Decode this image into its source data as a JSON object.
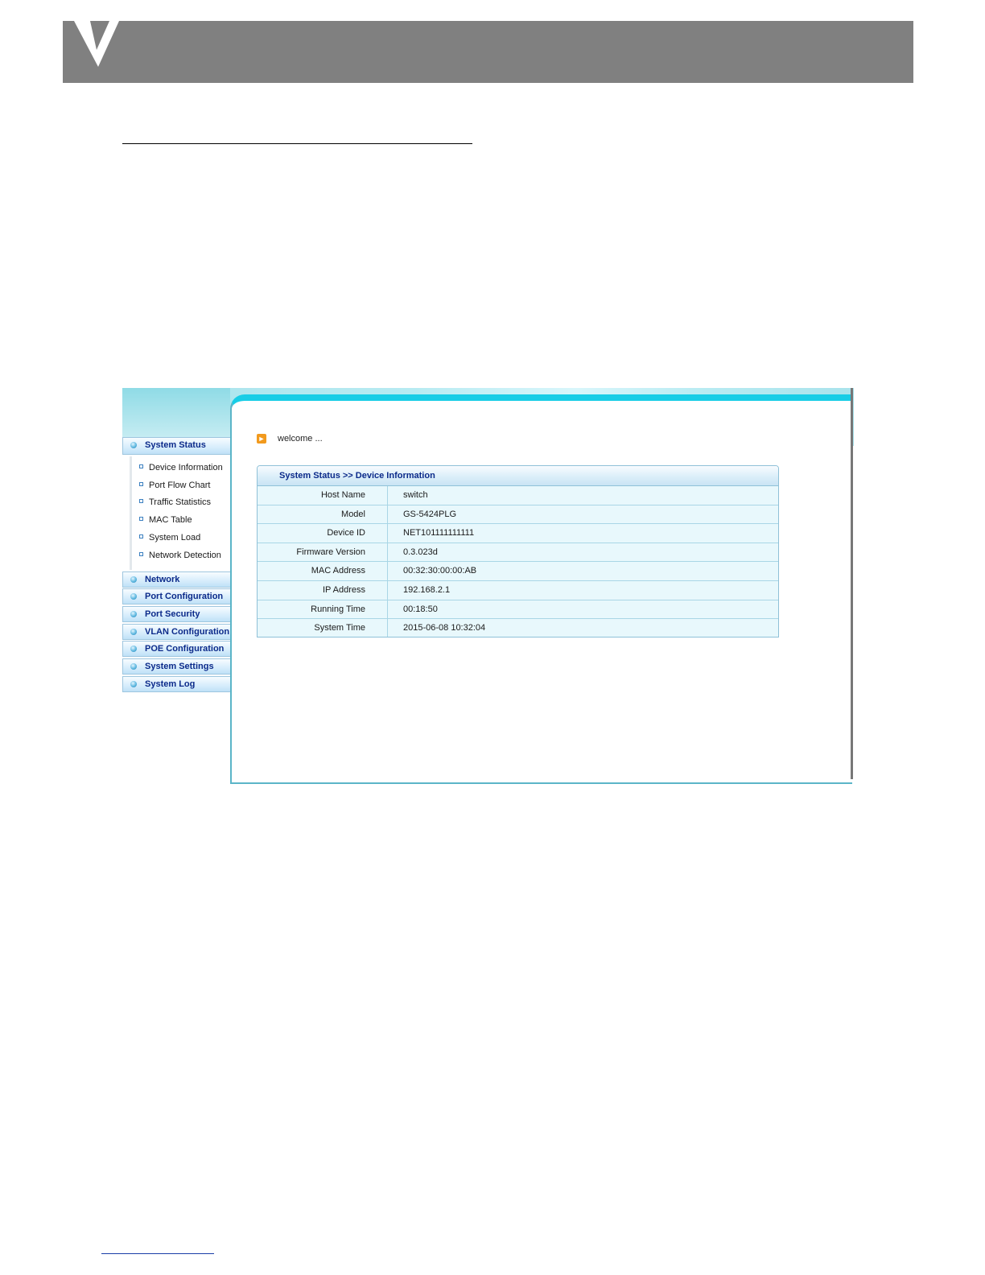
{
  "sidebar": {
    "groups": [
      {
        "label": "System Status",
        "open": true
      },
      {
        "label": "Network"
      },
      {
        "label": "Port Configuration"
      },
      {
        "label": "Port Security"
      },
      {
        "label": "VLAN Configuration"
      },
      {
        "label": "POE Configuration"
      },
      {
        "label": "System Settings"
      },
      {
        "label": "System Log"
      }
    ],
    "system_status_items": [
      "Device Information",
      "Port Flow Chart",
      "Traffic Statistics",
      "MAC Table",
      "System Load",
      "Network Detection"
    ]
  },
  "welcome": {
    "text": "welcome ..."
  },
  "device_info": {
    "title": "System Status >> Device Information",
    "rows": [
      {
        "label": "Host Name",
        "value": "switch"
      },
      {
        "label": "Model",
        "value": "GS-5424PLG"
      },
      {
        "label": "Device ID",
        "value": "NET101111111111"
      },
      {
        "label": "Firmware Version",
        "value": "0.3.023d"
      },
      {
        "label": "MAC Address",
        "value": "00:32:30:00:00:AB"
      },
      {
        "label": "IP Address",
        "value": "192.168.2.1"
      },
      {
        "label": "Running Time",
        "value": "00:18:50"
      },
      {
        "label": "System Time",
        "value": "2015-06-08 10:32:04"
      }
    ]
  },
  "colors": {
    "header_gray": "#808080",
    "accent_cyan": "#18cde6",
    "menu_text": "#0b2a8a",
    "welcome_icon": "#f29a1d"
  }
}
